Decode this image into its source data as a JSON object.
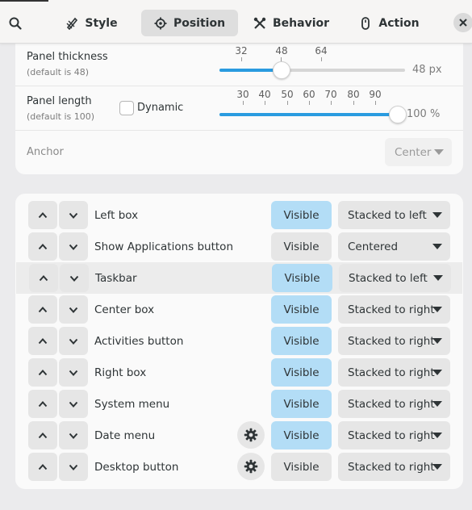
{
  "tabs": [
    {
      "label": "Style",
      "icon": "style-icon"
    },
    {
      "label": "Position",
      "icon": "position-icon",
      "active": true
    },
    {
      "label": "Behavior",
      "icon": "behavior-icon"
    },
    {
      "label": "Action",
      "icon": "action-icon"
    }
  ],
  "settings": {
    "thickness": {
      "label": "Panel thickness",
      "sub": "(default is 48)",
      "ticks": [
        "32",
        "48",
        "64"
      ],
      "value": 48,
      "value_text": "48 px"
    },
    "length": {
      "label": "Panel length",
      "sub": "(default is 100)",
      "dynamic_label": "Dynamic",
      "dynamic_checked": false,
      "ticks": [
        "30",
        "40",
        "50",
        "60",
        "70",
        "80",
        "90"
      ],
      "value": 100,
      "value_text": "100 %"
    },
    "anchor": {
      "label": "Anchor",
      "value": "Center"
    }
  },
  "items": [
    {
      "label": "Left box",
      "visibility": "Visible",
      "visible_on": true,
      "position": "Stacked to left",
      "gear": false
    },
    {
      "label": "Show Applications button",
      "visibility": "Visible",
      "visible_on": false,
      "position": "Centered",
      "gear": false
    },
    {
      "label": "Taskbar",
      "visibility": "Visible",
      "visible_on": true,
      "position": "Stacked to left",
      "gear": false,
      "highlighted": true
    },
    {
      "label": "Center box",
      "visibility": "Visible",
      "visible_on": true,
      "position": "Stacked to right",
      "gear": false
    },
    {
      "label": "Activities button",
      "visibility": "Visible",
      "visible_on": true,
      "position": "Stacked to right",
      "gear": false
    },
    {
      "label": "Right box",
      "visibility": "Visible",
      "visible_on": true,
      "position": "Stacked to right",
      "gear": false
    },
    {
      "label": "System menu",
      "visibility": "Visible",
      "visible_on": true,
      "position": "Stacked to right",
      "gear": false
    },
    {
      "label": "Date menu",
      "visibility": "Visible",
      "visible_on": true,
      "position": "Stacked to right",
      "gear": true
    },
    {
      "label": "Desktop button",
      "visibility": "Visible",
      "visible_on": false,
      "position": "Stacked to right",
      "gear": true
    }
  ],
  "colors": {
    "accent": "#2a9be0",
    "visible_on": "#b3ddf6",
    "button": "#e6e6e6"
  }
}
